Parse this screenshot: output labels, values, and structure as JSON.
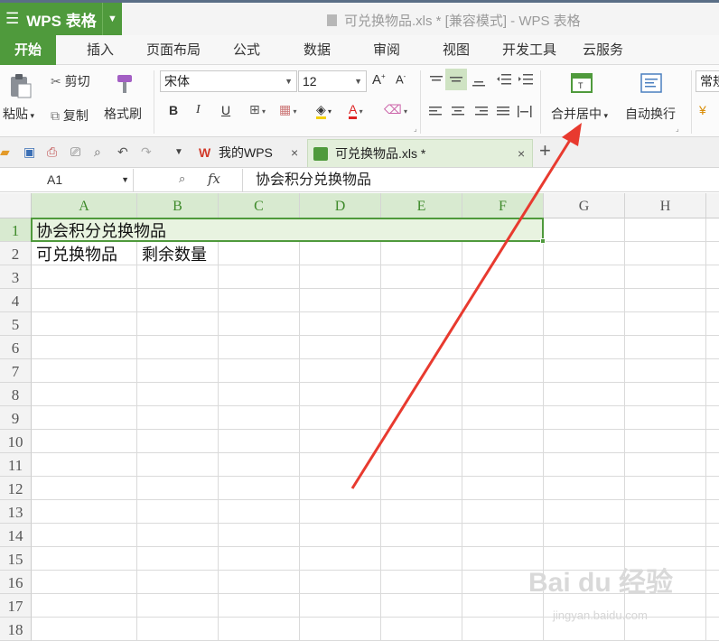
{
  "app": {
    "logo_text": "WPS 表格",
    "window_title": "可兑换物品.xls * [兼容模式] - WPS 表格"
  },
  "menu": {
    "tabs": [
      "开始",
      "插入",
      "页面布局",
      "公式",
      "数据",
      "审阅",
      "视图",
      "开发工具",
      "云服务"
    ],
    "active": "开始"
  },
  "ribbon": {
    "paste": "粘贴",
    "cut": "剪切",
    "copy": "复制",
    "format_painter": "格式刷",
    "font_name": "宋体",
    "font_size": "12",
    "merge_center": "合并居中",
    "wrap_text": "自动换行",
    "number_format": "常规"
  },
  "doc_tabs": {
    "home": "我的WPS",
    "file": "可兑换物品.xls *"
  },
  "formula_bar": {
    "name_box": "A1",
    "fx": "fx",
    "content": "协会积分兑换物品"
  },
  "sheet": {
    "columns": [
      "A",
      "B",
      "C",
      "D",
      "E",
      "F",
      "G",
      "H"
    ],
    "rows": [
      "1",
      "2",
      "3",
      "4",
      "5",
      "6",
      "7",
      "8",
      "9",
      "10",
      "11",
      "12",
      "13",
      "14",
      "15",
      "16",
      "17",
      "18"
    ],
    "cells": {
      "A1": "协会积分兑换物品",
      "A2": "可兑换物品",
      "B2": "剩余数量"
    }
  },
  "watermark": {
    "brand": "Bai du 经验",
    "url": "jingyan.baidu.com"
  },
  "colors": {
    "accent": "#4f9a3c",
    "annotation_arrow": "#e83a2f"
  }
}
